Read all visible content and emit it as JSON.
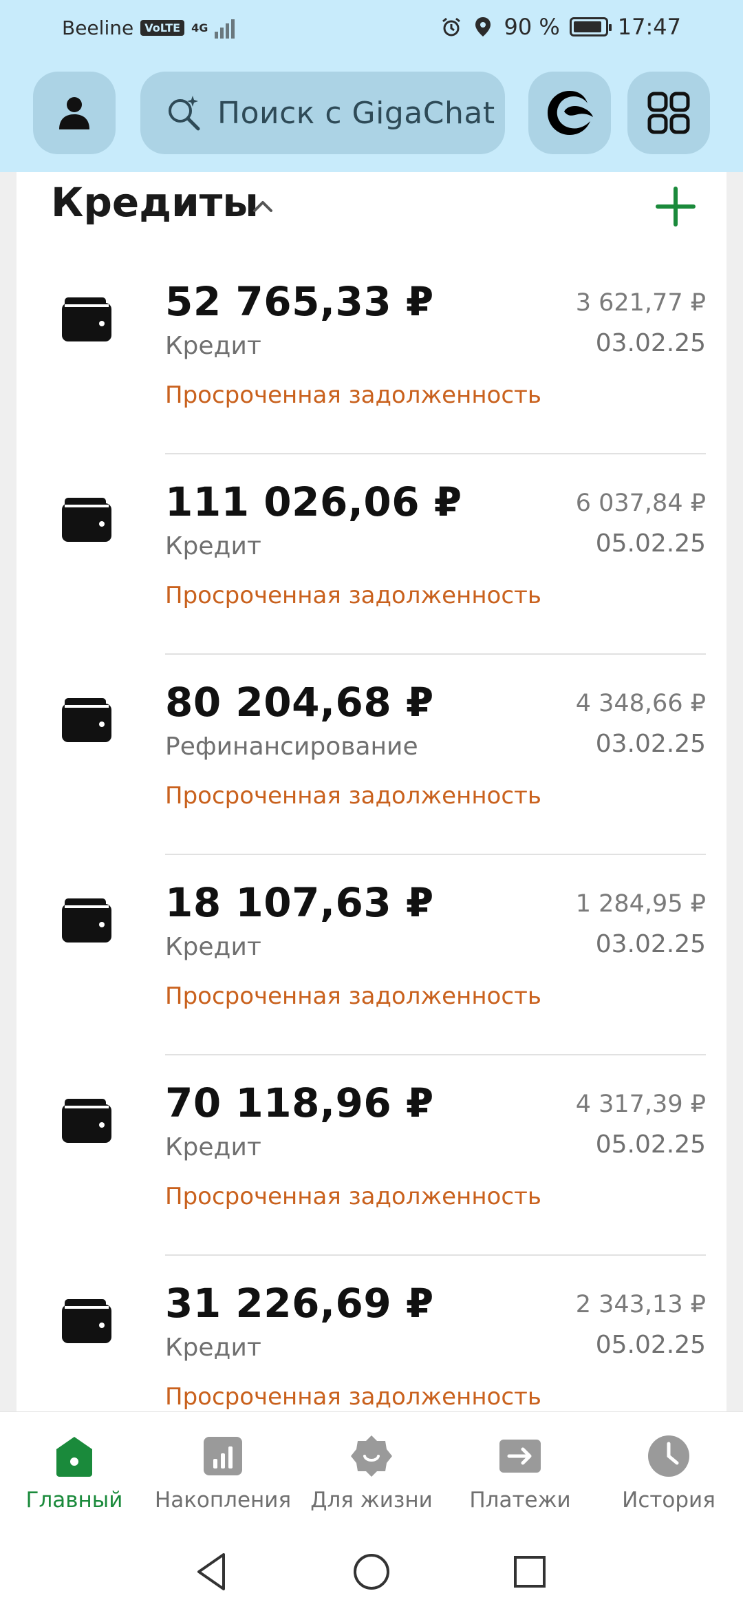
{
  "status_bar": {
    "carrier": "Beeline",
    "volte": "VoLTE",
    "network": "4G",
    "battery": "90 %",
    "battery_level": 0.9,
    "time": "17:47"
  },
  "header": {
    "search_placeholder": "Поиск с GigaChat",
    "icons": [
      "profile-icon",
      "search-sparkle-icon",
      "gigachat-logo-icon",
      "apps-grid-icon"
    ]
  },
  "section": {
    "title": "Кредиты",
    "collapse_icon": "chevron-up-icon",
    "add_icon": "plus-icon",
    "accent_color": "#1a8a3b",
    "status_color": "#c9611d"
  },
  "credits": [
    {
      "amount": "52 765,33 ₽",
      "type": "Кредит",
      "status": "Просроченная задолженность",
      "payment": "3 621,77 ₽",
      "date": "03.02.25"
    },
    {
      "amount": "111 026,06 ₽",
      "type": "Кредит",
      "status": "Просроченная задолженность",
      "payment": "6 037,84 ₽",
      "date": "05.02.25"
    },
    {
      "amount": "80 204,68 ₽",
      "type": "Рефинансирование",
      "status": "Просроченная задолженность",
      "payment": "4 348,66 ₽",
      "date": "03.02.25"
    },
    {
      "amount": "18 107,63 ₽",
      "type": "Кредит",
      "status": "Просроченная задолженность",
      "payment": "1 284,95 ₽",
      "date": "03.02.25"
    },
    {
      "amount": "70 118,96 ₽",
      "type": "Кредит",
      "status": "Просроченная задолженность",
      "payment": "4 317,39 ₽",
      "date": "05.02.25"
    },
    {
      "amount": "31 226,69 ₽",
      "type": "Кредит",
      "status": "Просроченная задолженность",
      "payment": "2 343,13 ₽",
      "date": "05.02.25"
    }
  ],
  "bottom_nav": [
    {
      "label": "Главный",
      "icon": "home-icon",
      "active": true
    },
    {
      "label": "Накопления",
      "icon": "savings-chart-icon",
      "active": false
    },
    {
      "label": "Для жизни",
      "icon": "lifestyle-icon",
      "active": false
    },
    {
      "label": "Платежи",
      "icon": "payments-arrow-icon",
      "active": false
    },
    {
      "label": "История",
      "icon": "history-clock-icon",
      "active": false
    }
  ],
  "system_nav": [
    "back-icon",
    "home-circle-icon",
    "recents-icon"
  ]
}
